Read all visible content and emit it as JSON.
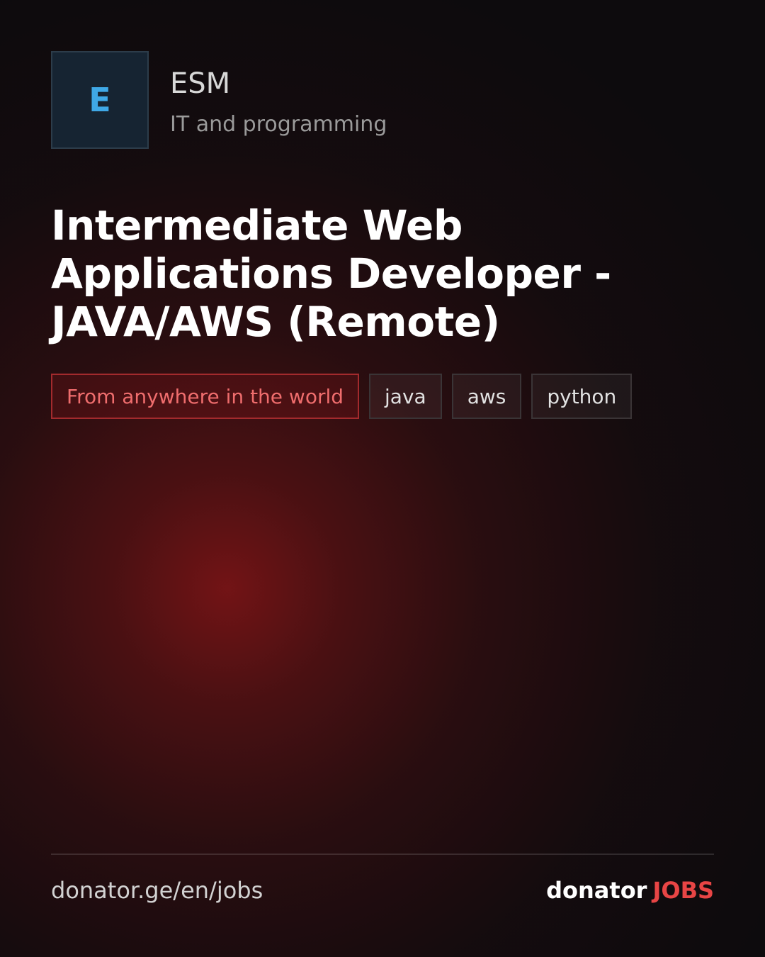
{
  "company": {
    "logo_letter": "E",
    "name": "ESM",
    "category": "IT and programming"
  },
  "job": {
    "title": "Intermediate Web Applications Developer - JAVA/AWS  (Remote)"
  },
  "tags": {
    "location": "From anywhere in the world",
    "skills": [
      "java",
      "aws",
      "python"
    ]
  },
  "footer": {
    "url": "donator.ge/en/jobs",
    "brand_name": "donator",
    "brand_suffix": "JOBS"
  },
  "colors": {
    "accent_red": "#e84545",
    "logo_blue": "#3fa8e6",
    "background": "#0d0b0d"
  }
}
